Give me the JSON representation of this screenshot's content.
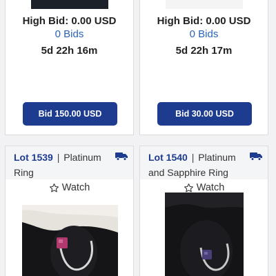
{
  "lots_top": [
    {
      "high_bid": "High Bid: 0.00 USD",
      "bids": "0 Bids",
      "time_left": "5d 22h 16m",
      "bid_button": "Bid 150.00 USD"
    },
    {
      "high_bid": "High Bid: 0.00 USD",
      "bids": "0 Bids",
      "time_left": "5d 22h 17m",
      "bid_button": "Bid 30.00 USD"
    }
  ],
  "lots_bottom": [
    {
      "lot_number": "Lot 1539",
      "separator": "|",
      "title_a": "Platinum",
      "title_b": "Ring",
      "watch_label": "Watch",
      "shipping_icon": "truck-icon",
      "stone_color": "#b03a6e"
    },
    {
      "lot_number": "Lot 1540",
      "separator": "|",
      "title_a": "Platinum",
      "title_b": "and Sapphire Ring",
      "watch_label": "Watch",
      "shipping_icon": "truck-icon",
      "stone_color": "#4a3f78"
    }
  ],
  "colors": {
    "accent": "#1d3b8f",
    "link": "#2a63b8"
  }
}
